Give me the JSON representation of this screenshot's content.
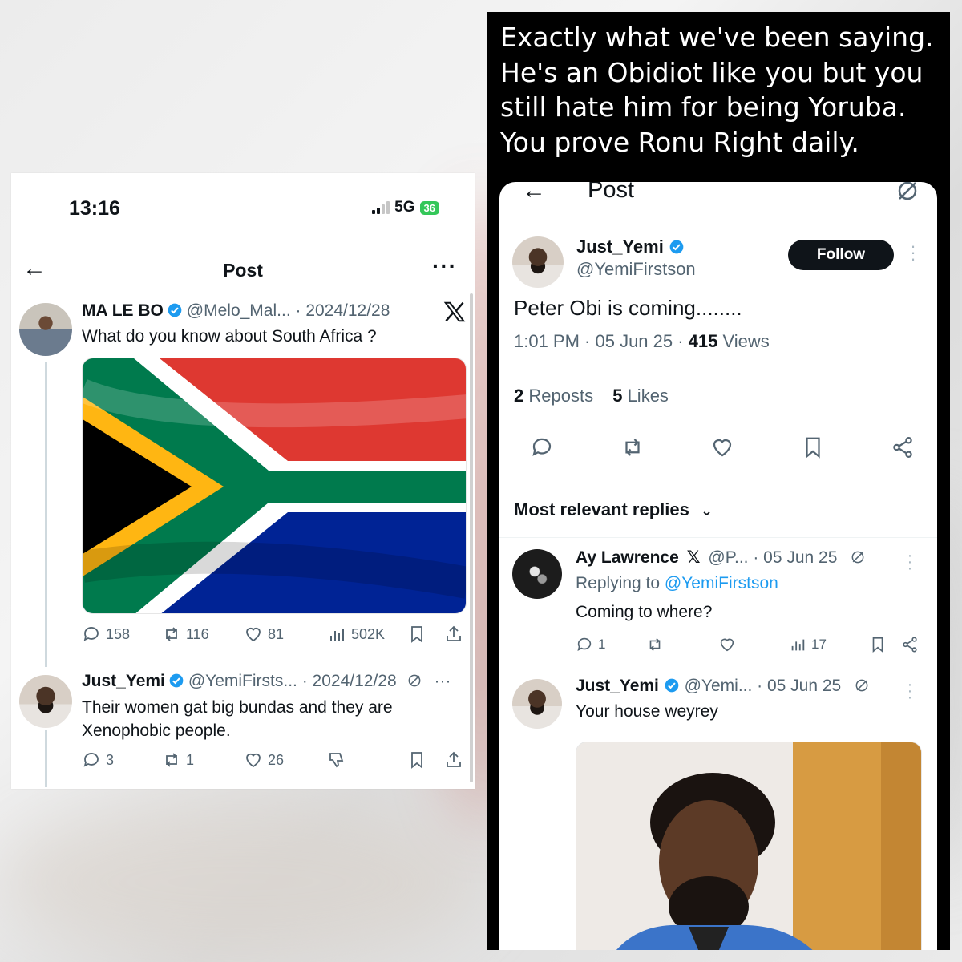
{
  "left": {
    "status": {
      "time": "13:16",
      "network": "5G",
      "battery": "36"
    },
    "header": {
      "title": "Post"
    },
    "post1": {
      "name": "MA LE BO",
      "handle_date": "@Melo_Mal... · 2024/12/28",
      "text": "What do you know about South Africa ?",
      "image": "south-africa-flag",
      "replies": "158",
      "reposts": "116",
      "likes": "81",
      "views": "502K"
    },
    "post2": {
      "name": "Just_Yemi",
      "handle_date": "@YemiFirsts... · 2024/12/28",
      "text": "Their women gat big bundas and they are Xenophobic people.",
      "replies": "3",
      "reposts": "1",
      "likes": "26"
    }
  },
  "right": {
    "caption": "Exactly what we've been saying. He's an Obidiot like you but you still hate him for being Yoruba. You prove Ronu Right daily.",
    "header": {
      "title": "Post"
    },
    "main_post": {
      "name": "Just_Yemi",
      "handle": "@YemiFirstson",
      "follow_label": "Follow",
      "text": "Peter Obi is coming........",
      "time": "1:01 PM · 05 Jun 25 · ",
      "views_count": "415",
      "views_label": " Views",
      "reposts_count": "2",
      "reposts_label": " Reposts",
      "likes_count": "5",
      "likes_label": " Likes"
    },
    "replies_heading": "Most relevant replies",
    "reply1": {
      "name": "Ay Lawrence",
      "handle_date": "@P...  · 05 Jun 25",
      "replying_to_label": "Replying to ",
      "replying_to_handle": "@YemiFirstson",
      "text": "Coming to where?",
      "replies": "1",
      "views": "17"
    },
    "reply2": {
      "name": "Just_Yemi",
      "handle_date": "@Yemi...  · 05 Jun 25",
      "text": "Your house weyrey",
      "image": "meme-photo"
    }
  }
}
